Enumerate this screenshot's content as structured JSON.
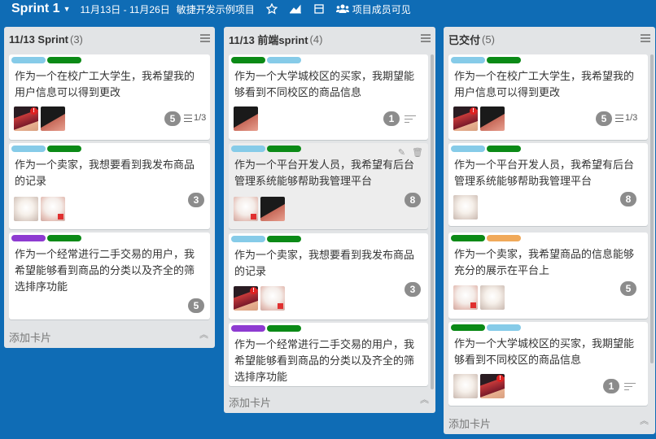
{
  "topbar": {
    "board_title": "Sprint 1",
    "date_range": "11月13日 - 11月26日",
    "project": "敏捷开发示例项目",
    "visibility": "项目成员可见",
    "icons": [
      "chevron-down-icon",
      "star-icon",
      "chart-icon",
      "panel-icon",
      "users-icon"
    ]
  },
  "colors": {
    "green": "#0b8a16",
    "blue": "#86cbe8",
    "purple": "#8e3bd1",
    "orange": "#f0a95a",
    "badge": "#8c8c8c",
    "board": "#0f6cb5",
    "list": "#e2e4e6"
  },
  "lists": [
    {
      "title": "11/13 Sprint",
      "count": "(3)",
      "add_label": "添加卡片",
      "cards": [
        {
          "labels": [
            "blue",
            "green"
          ],
          "title": "作为一个在校广工大学生，我希望我的用户信息可以得到更改",
          "avatars": [
            "red",
            "dark"
          ],
          "points": "5",
          "checklist": "1/3"
        },
        {
          "labels": [
            "blue",
            "green"
          ],
          "title": "作为一个卖家，我想要看到我发布商品的记录",
          "avatars": [
            "anime",
            "pink"
          ],
          "points": "3"
        },
        {
          "labels": [
            "purple",
            "green"
          ],
          "title": "作为一个经常进行二手交易的用户，我希望能够看到商品的分类以及齐全的筛选排序功能",
          "avatars": [],
          "points": "5"
        }
      ]
    },
    {
      "title": "11/13 前端sprint",
      "count": "(4)",
      "add_label": "添加卡片",
      "cards": [
        {
          "labels": [
            "green",
            "blue"
          ],
          "title": "作为一个大学城校区的买家，我期望能够看到不同校区的商品信息",
          "avatars": [
            "dark"
          ],
          "points": "1",
          "has_description": true
        },
        {
          "labels": [
            "blue",
            "green"
          ],
          "title": "作为一个平台开发人员，我希望有后台管理系统能够帮助我管理平台",
          "avatars": [
            "pink",
            "dark"
          ],
          "points": "8",
          "hovered": true
        },
        {
          "labels": [
            "blue",
            "green"
          ],
          "title": "作为一个卖家，我想要看到我发布商品的记录",
          "avatars": [
            "red",
            "pink"
          ],
          "points": "3"
        },
        {
          "labels": [
            "purple",
            "green"
          ],
          "title": "作为一个经常进行二手交易的用户，我希望能够看到商品的分类以及齐全的筛选排序功能",
          "avatars": [],
          "points": ""
        }
      ]
    },
    {
      "title": "已交付",
      "count": "(5)",
      "add_label": "添加卡片",
      "cards": [
        {
          "labels": [
            "blue",
            "green"
          ],
          "title": "作为一个在校广工大学生，我希望我的用户信息可以得到更改",
          "avatars": [
            "red",
            "dark"
          ],
          "points": "5",
          "checklist": "1/3"
        },
        {
          "labels": [
            "blue",
            "green"
          ],
          "title": "作为一个平台开发人员，我希望有后台管理系统能够帮助我管理平台",
          "avatars": [
            "anime"
          ],
          "points": "8"
        },
        {
          "labels": [
            "green",
            "orange"
          ],
          "title": "作为一个卖家，我希望商品的信息能够充分的展示在平台上",
          "avatars": [
            "pink",
            "anime"
          ],
          "points": "5"
        },
        {
          "labels": [
            "green",
            "blue"
          ],
          "title": "作为一个大学城校区的买家，我期望能够看到不同校区的商品信息",
          "avatars": [
            "anime",
            "red"
          ],
          "points": "1",
          "has_description": true
        }
      ]
    }
  ]
}
